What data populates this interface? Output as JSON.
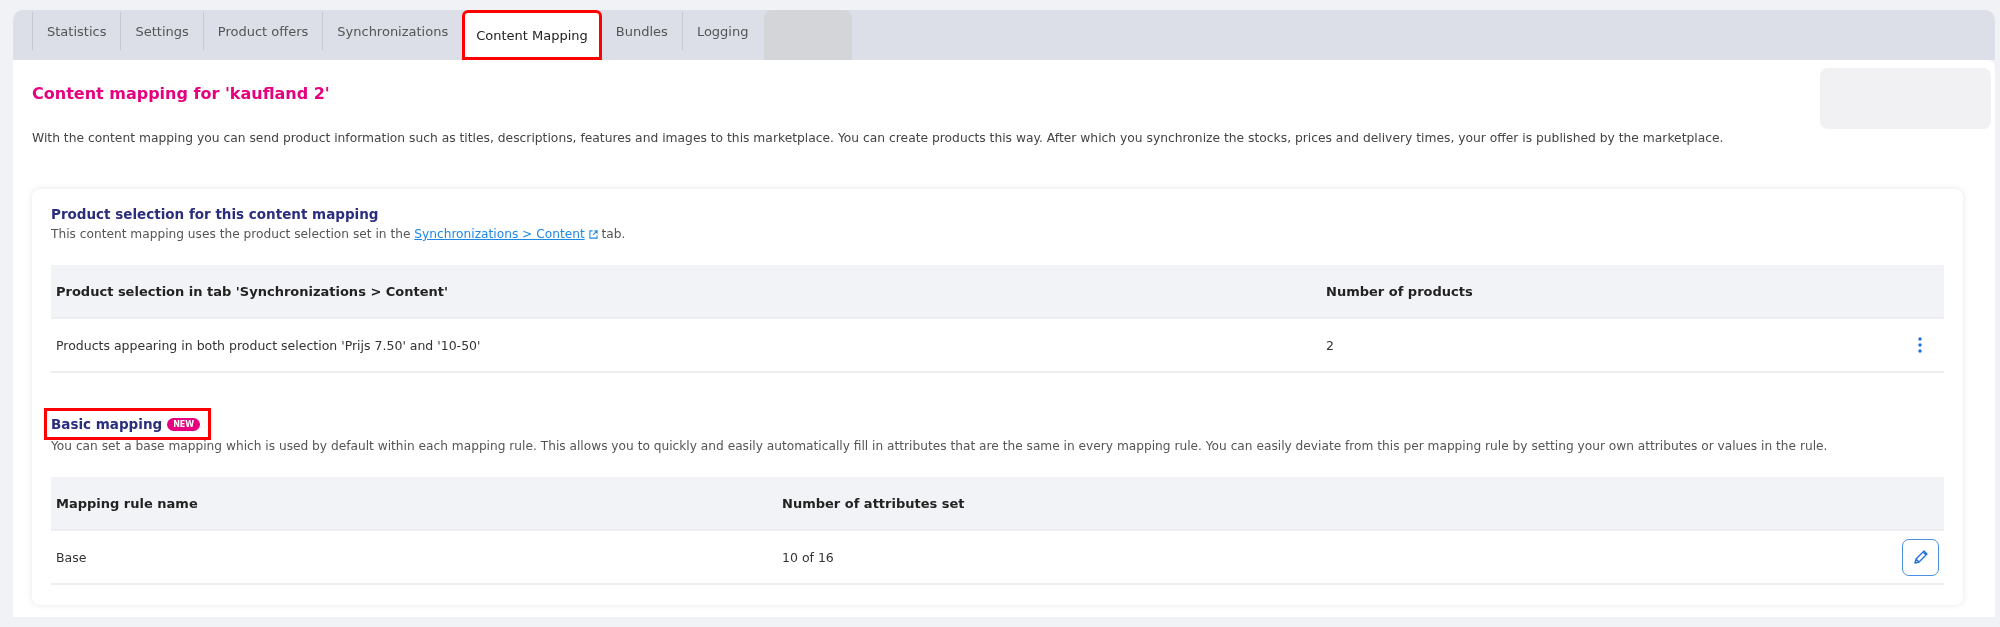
{
  "tabs": [
    {
      "label": "Statistics",
      "selected": false,
      "highlighted": false
    },
    {
      "label": "Settings",
      "selected": false,
      "highlighted": false
    },
    {
      "label": "Product offers",
      "selected": false,
      "highlighted": false
    },
    {
      "label": "Synchronizations",
      "selected": false,
      "highlighted": false
    },
    {
      "label": "Content Mapping",
      "selected": true,
      "highlighted": true
    },
    {
      "label": "Bundles",
      "selected": false,
      "highlighted": false
    },
    {
      "label": "Logging",
      "selected": false,
      "highlighted": false
    }
  ],
  "page": {
    "title": "Content mapping for 'kaufland 2'",
    "description": "With the content mapping you can send product information such as titles, descriptions, features and images to this marketplace. You can create products this way. After which you synchronize the stocks, prices and delivery times, your offer is published by the marketplace."
  },
  "sections": [
    {
      "title": "Product selection for this content mapping",
      "intro": {
        "before": "This content mapping uses the product selection set in the",
        "link": "Synchronizations > Content",
        "after": "tab."
      },
      "table": {
        "columns": [
          "Product selection in tab 'Synchronizations > Content'",
          "Number of products"
        ],
        "rows": [
          {
            "cells": [
              "Products appearing in both product selection 'Prijs 7.50' and '10-50'",
              "2"
            ],
            "kind": "menu"
          }
        ]
      }
    },
    {
      "title": "Basic mapping",
      "badge": "NEW",
      "highlighted": true,
      "intro": {
        "before": "You can set a base mapping which is used by default within each mapping rule. This allows you to quickly and easily automatically fill in attributes that are the same in every mapping rule. You can easily deviate from this per mapping rule by setting your own attributes or values in the rule."
      },
      "table": {
        "columns": [
          "Mapping rule name",
          "Number of attributes set"
        ],
        "rows": [
          {
            "cells": [
              "Base",
              "10 of 16"
            ],
            "kind": "edit"
          }
        ]
      }
    }
  ]
}
